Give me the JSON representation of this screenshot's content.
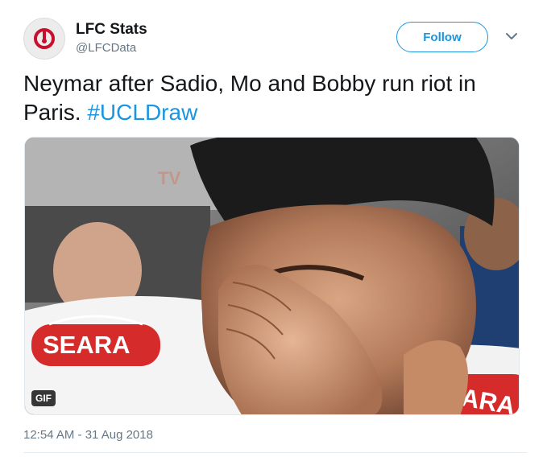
{
  "tweet": {
    "author_name": "LFC Stats",
    "author_handle": "@LFCData",
    "follow_label": "Follow",
    "text_main": "Neymar after Sadio, Mo and Bobby run riot in Paris.",
    "hashtag": "#UCLDraw",
    "timestamp": "12:54 AM - 31 Aug 2018"
  },
  "media": {
    "type": "gif",
    "badge": "GIF",
    "sponsor_text_left": "SEARA",
    "sponsor_text_right": "EARA",
    "background_text": "TV"
  },
  "colors": {
    "link": "#1b95e0",
    "text": "#14171a",
    "muted": "#657786",
    "shirt_red": "#d62b2b"
  },
  "icons": {
    "avatar": "lfc-logo-icon",
    "caret": "chevron-down-icon"
  }
}
